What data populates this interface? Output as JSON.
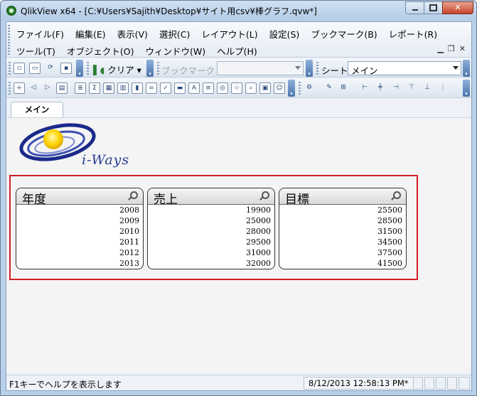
{
  "window": {
    "title": "QlikView x64 - [C:¥Users¥Sajith¥Desktop¥サイト用csv¥棒グラフ.qvw*]",
    "minimize_icon": "minimize-icon",
    "maximize_icon": "maximize-icon",
    "close_icon": "close-icon",
    "close_label": "✕"
  },
  "menu": {
    "row1": [
      "ファイル(F)",
      "編集(E)",
      "表示(V)",
      "選択(C)",
      "レイアウト(L)",
      "設定(S)",
      "ブックマーク(B)",
      "レポート(R)"
    ],
    "row2": [
      "ツール(T)",
      "オブジェクト(O)",
      "ウィンドウ(W)",
      "ヘルプ(H)"
    ]
  },
  "toolbar": {
    "clear_label": "クリア ▾",
    "bookmark_label": "ブックマーク",
    "bookmark_value": "",
    "sheet_label": "シート",
    "sheet_value": "メイン"
  },
  "tabs": [
    {
      "label": "メイン",
      "active": true
    }
  ],
  "logo": {
    "text": "i-Ways"
  },
  "listboxes": [
    {
      "title": "年度",
      "values": [
        "2008",
        "2009",
        "2010",
        "2011",
        "2012",
        "2013"
      ]
    },
    {
      "title": "売上",
      "values": [
        "19900",
        "25000",
        "28000",
        "29500",
        "31000",
        "32000"
      ]
    },
    {
      "title": "目標",
      "values": [
        "25500",
        "28500",
        "31500",
        "34500",
        "37500",
        "41500"
      ]
    }
  ],
  "status": {
    "help_text": "F1キーでヘルプを表示します",
    "timestamp": "8/12/2013 12:58:13 PM*"
  },
  "colors": {
    "highlight_border": "#d21e26"
  }
}
